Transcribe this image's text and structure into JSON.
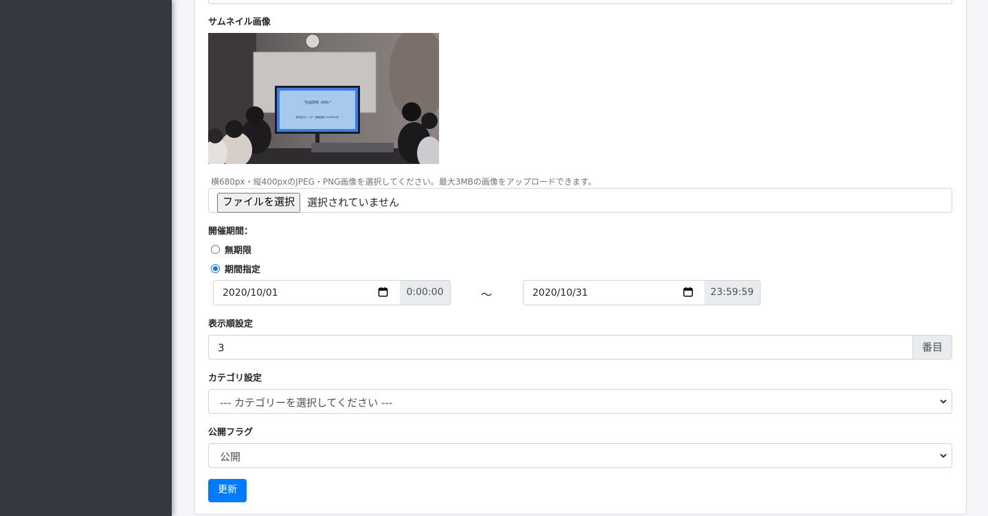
{
  "thumbnail": {
    "label": "サムネイル画像",
    "slide_title": "\"社員研修 -DNS-\"",
    "slide_subtitle": "株式会社レーザー 無線技術 2020年10月",
    "help_text": "横680px・縦400pxのJPEG・PNG画像を選択してください。最大3MBの画像をアップロードできます。",
    "file_button": "ファイルを選択",
    "file_status": "選択されていません"
  },
  "period": {
    "label": "開催期間：",
    "option_unlimited": "無期限",
    "option_specified": "期間指定",
    "selected": "期間指定",
    "start_date": "2020/10/01",
    "start_time": "0:00:00",
    "separator": "〜",
    "end_date": "2020/10/31",
    "end_time": "23:59:59"
  },
  "display_order": {
    "label": "表示順設定",
    "value": "3",
    "suffix": "番目"
  },
  "category": {
    "label": "カテゴリ設定",
    "selected": "--- カテゴリーを選択してください ---"
  },
  "publish": {
    "label": "公開フラグ",
    "selected": "公開"
  },
  "submit_label": "更新",
  "colors": {
    "sidebar": "#343a40",
    "primary": "#007bff",
    "addon_bg": "#e9ecef"
  }
}
